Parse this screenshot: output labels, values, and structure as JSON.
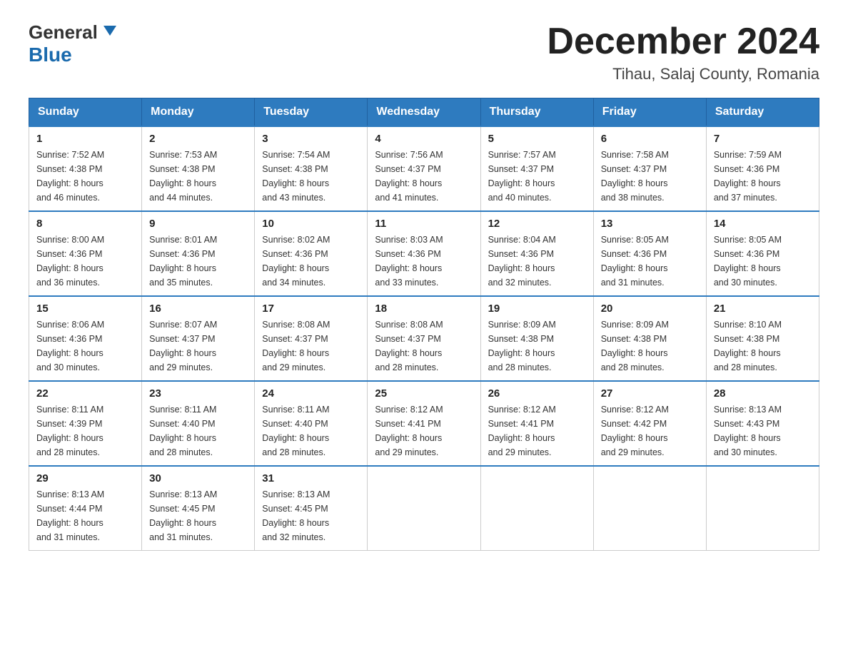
{
  "header": {
    "logo_general": "General",
    "logo_blue": "Blue",
    "title": "December 2024",
    "subtitle": "Tihau, Salaj County, Romania"
  },
  "calendar": {
    "days_of_week": [
      "Sunday",
      "Monday",
      "Tuesday",
      "Wednesday",
      "Thursday",
      "Friday",
      "Saturday"
    ],
    "weeks": [
      [
        {
          "day": "1",
          "sunrise": "7:52 AM",
          "sunset": "4:38 PM",
          "daylight": "8 hours and 46 minutes."
        },
        {
          "day": "2",
          "sunrise": "7:53 AM",
          "sunset": "4:38 PM",
          "daylight": "8 hours and 44 minutes."
        },
        {
          "day": "3",
          "sunrise": "7:54 AM",
          "sunset": "4:38 PM",
          "daylight": "8 hours and 43 minutes."
        },
        {
          "day": "4",
          "sunrise": "7:56 AM",
          "sunset": "4:37 PM",
          "daylight": "8 hours and 41 minutes."
        },
        {
          "day": "5",
          "sunrise": "7:57 AM",
          "sunset": "4:37 PM",
          "daylight": "8 hours and 40 minutes."
        },
        {
          "day": "6",
          "sunrise": "7:58 AM",
          "sunset": "4:37 PM",
          "daylight": "8 hours and 38 minutes."
        },
        {
          "day": "7",
          "sunrise": "7:59 AM",
          "sunset": "4:36 PM",
          "daylight": "8 hours and 37 minutes."
        }
      ],
      [
        {
          "day": "8",
          "sunrise": "8:00 AM",
          "sunset": "4:36 PM",
          "daylight": "8 hours and 36 minutes."
        },
        {
          "day": "9",
          "sunrise": "8:01 AM",
          "sunset": "4:36 PM",
          "daylight": "8 hours and 35 minutes."
        },
        {
          "day": "10",
          "sunrise": "8:02 AM",
          "sunset": "4:36 PM",
          "daylight": "8 hours and 34 minutes."
        },
        {
          "day": "11",
          "sunrise": "8:03 AM",
          "sunset": "4:36 PM",
          "daylight": "8 hours and 33 minutes."
        },
        {
          "day": "12",
          "sunrise": "8:04 AM",
          "sunset": "4:36 PM",
          "daylight": "8 hours and 32 minutes."
        },
        {
          "day": "13",
          "sunrise": "8:05 AM",
          "sunset": "4:36 PM",
          "daylight": "8 hours and 31 minutes."
        },
        {
          "day": "14",
          "sunrise": "8:05 AM",
          "sunset": "4:36 PM",
          "daylight": "8 hours and 30 minutes."
        }
      ],
      [
        {
          "day": "15",
          "sunrise": "8:06 AM",
          "sunset": "4:36 PM",
          "daylight": "8 hours and 30 minutes."
        },
        {
          "day": "16",
          "sunrise": "8:07 AM",
          "sunset": "4:37 PM",
          "daylight": "8 hours and 29 minutes."
        },
        {
          "day": "17",
          "sunrise": "8:08 AM",
          "sunset": "4:37 PM",
          "daylight": "8 hours and 29 minutes."
        },
        {
          "day": "18",
          "sunrise": "8:08 AM",
          "sunset": "4:37 PM",
          "daylight": "8 hours and 28 minutes."
        },
        {
          "day": "19",
          "sunrise": "8:09 AM",
          "sunset": "4:38 PM",
          "daylight": "8 hours and 28 minutes."
        },
        {
          "day": "20",
          "sunrise": "8:09 AM",
          "sunset": "4:38 PM",
          "daylight": "8 hours and 28 minutes."
        },
        {
          "day": "21",
          "sunrise": "8:10 AM",
          "sunset": "4:38 PM",
          "daylight": "8 hours and 28 minutes."
        }
      ],
      [
        {
          "day": "22",
          "sunrise": "8:11 AM",
          "sunset": "4:39 PM",
          "daylight": "8 hours and 28 minutes."
        },
        {
          "day": "23",
          "sunrise": "8:11 AM",
          "sunset": "4:40 PM",
          "daylight": "8 hours and 28 minutes."
        },
        {
          "day": "24",
          "sunrise": "8:11 AM",
          "sunset": "4:40 PM",
          "daylight": "8 hours and 28 minutes."
        },
        {
          "day": "25",
          "sunrise": "8:12 AM",
          "sunset": "4:41 PM",
          "daylight": "8 hours and 29 minutes."
        },
        {
          "day": "26",
          "sunrise": "8:12 AM",
          "sunset": "4:41 PM",
          "daylight": "8 hours and 29 minutes."
        },
        {
          "day": "27",
          "sunrise": "8:12 AM",
          "sunset": "4:42 PM",
          "daylight": "8 hours and 29 minutes."
        },
        {
          "day": "28",
          "sunrise": "8:13 AM",
          "sunset": "4:43 PM",
          "daylight": "8 hours and 30 minutes."
        }
      ],
      [
        {
          "day": "29",
          "sunrise": "8:13 AM",
          "sunset": "4:44 PM",
          "daylight": "8 hours and 31 minutes."
        },
        {
          "day": "30",
          "sunrise": "8:13 AM",
          "sunset": "4:45 PM",
          "daylight": "8 hours and 31 minutes."
        },
        {
          "day": "31",
          "sunrise": "8:13 AM",
          "sunset": "4:45 PM",
          "daylight": "8 hours and 32 minutes."
        },
        null,
        null,
        null,
        null
      ]
    ],
    "labels": {
      "sunrise": "Sunrise:",
      "sunset": "Sunset:",
      "daylight": "Daylight:"
    }
  }
}
